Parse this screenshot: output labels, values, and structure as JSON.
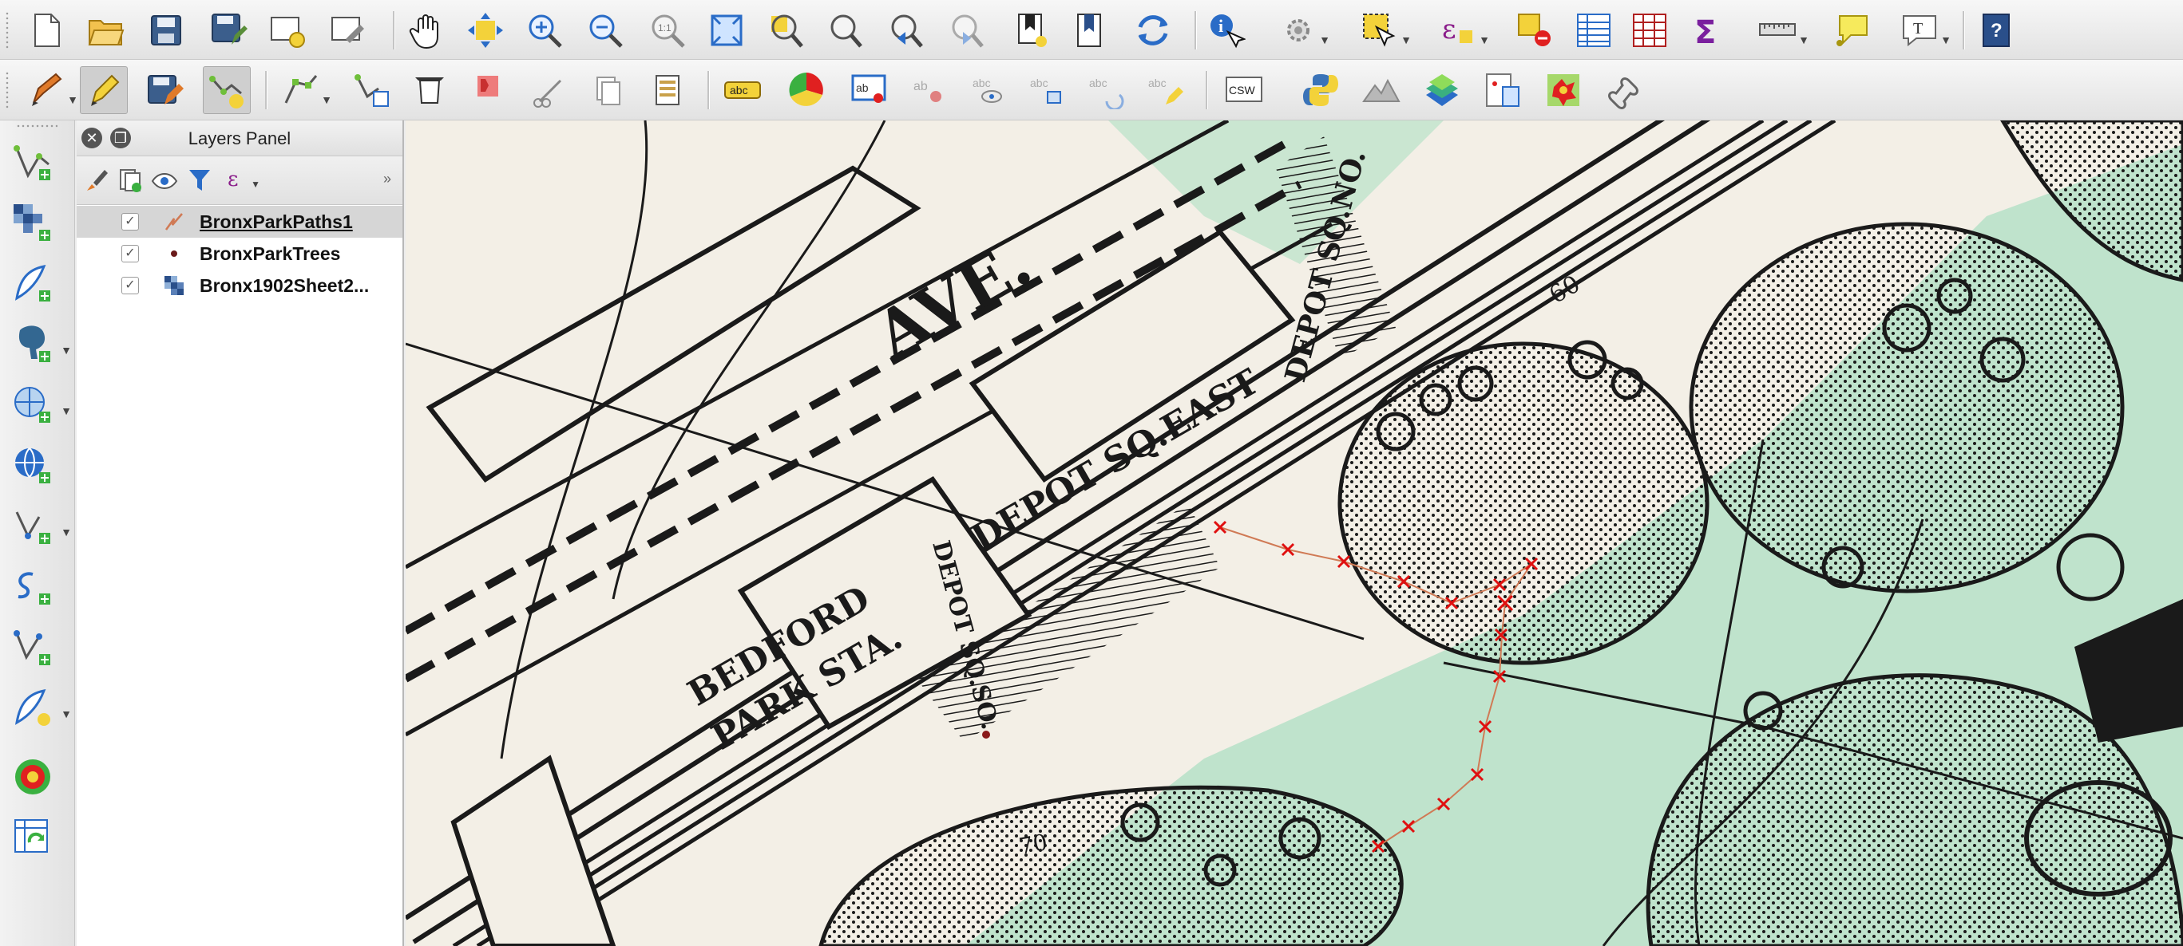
{
  "top_toolbar": {
    "icons": [
      "new-project-icon",
      "open-project-icon",
      "save-project-icon",
      "save-as-icon",
      "new-print-composer-icon",
      "composer-manager-icon",
      "pan-icon",
      "pan-to-selection-icon",
      "zoom-in-icon",
      "zoom-out-icon",
      "zoom-native-icon",
      "zoom-full-icon",
      "zoom-to-selection-icon",
      "zoom-to-layer-icon",
      "zoom-last-icon",
      "zoom-next-icon",
      "new-bookmark-icon",
      "show-bookmarks-icon",
      "refresh-icon",
      "identify-icon",
      "select-icon",
      "select-features-icon",
      "expression-select-icon",
      "deselect-icon",
      "attribute-table-icon",
      "field-calculator-icon",
      "statistics-icon",
      "measure-icon",
      "map-tips-icon",
      "text-annotation-icon",
      "whats-this-icon"
    ]
  },
  "digitizing_toolbar": {
    "icons": [
      "current-edits-icon",
      "toggle-editing-icon",
      "save-edits-icon",
      "add-feature-icon",
      "node-tool-icon",
      "move-feature-icon",
      "delete-selected-icon",
      "cut-features-icon",
      "copy-features-icon",
      "paste-features-icon",
      "label-icon",
      "diagram-icon",
      "pin-labels-icon",
      "show-hide-labels-icon",
      "move-label-icon",
      "rotate-label-icon",
      "change-label-icon",
      "csw-icon",
      "python-console-icon",
      "terrain-icon",
      "layer-styling-icon",
      "georeferencer-icon",
      "heatmap-plugin-icon",
      "gps-tools-icon"
    ],
    "csw_label": "CSW",
    "label_badge": "abc"
  },
  "left_toolbar": {
    "icons": [
      "add-vector-layer-icon",
      "add-raster-layer-icon",
      "add-delimited-text-icon",
      "add-postgis-icon",
      "add-spatialite-icon",
      "add-wms-icon",
      "add-mssql-icon",
      "add-oracle-icon",
      "add-wfs-icon",
      "new-shapefile-icon",
      "heatmap-icon",
      "refresh-layers-icon"
    ]
  },
  "layers_panel": {
    "title": "Layers Panel",
    "layers": [
      {
        "name": "BronxParkPaths1",
        "checked": true,
        "selected": true,
        "type": "line"
      },
      {
        "name": "BronxParkTrees",
        "checked": true,
        "selected": false,
        "type": "point"
      },
      {
        "name": "Bronx1902Sheet2...",
        "checked": true,
        "selected": false,
        "type": "raster"
      }
    ]
  },
  "map": {
    "labels": {
      "ave": "AVE.",
      "depot_sq_east": "DEPOT SQ.EAST",
      "depot_sq_no": "DEPOT SQ.NO.",
      "depot_sq_so": "DEPOT SQ.SO.",
      "bedford": "BEDFORD",
      "park_sta": "PARK STA.",
      "elev_60": "60",
      "elev_70": "70"
    },
    "colors": {
      "paper": "#f3efe6",
      "park": "#bfe3cc",
      "ink": "#1a1a1a",
      "path_line": "#d07a55",
      "vertex": "#e01010"
    }
  }
}
